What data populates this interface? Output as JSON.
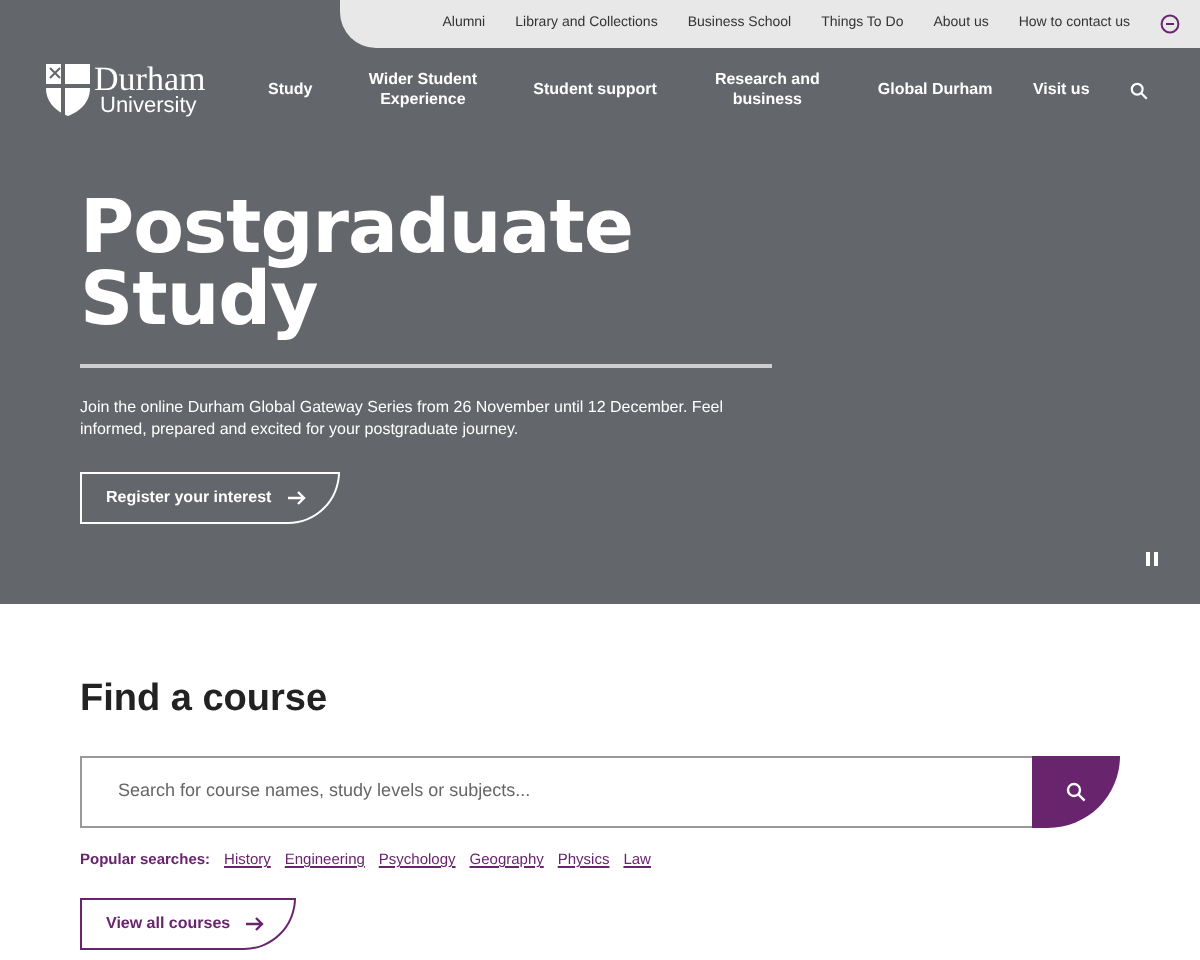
{
  "utility_nav": [
    "Alumni",
    "Library and Collections",
    "Business School",
    "Things To Do",
    "About us",
    "How to contact us"
  ],
  "logo": {
    "name": "Durham",
    "subtitle": "University"
  },
  "main_nav": [
    "Study",
    "Wider Student Experience",
    "Student support",
    "Research and business",
    "Global Durham",
    "Visit us"
  ],
  "hero": {
    "title": "Postgraduate Study",
    "text": "Join the online Durham Global Gateway Series from 26 November until 12 December. Feel informed, prepared and excited for your postgraduate journey.",
    "button": "Register your interest"
  },
  "find_course": {
    "title": "Find a course",
    "search": {
      "placeholder": "Search for course names, study levels or subjects..."
    },
    "popular_label": "Popular searches:",
    "popular": [
      "History",
      "Engineering",
      "Psychology",
      "Geography",
      "Physics",
      "Law"
    ],
    "button": "View all courses"
  }
}
